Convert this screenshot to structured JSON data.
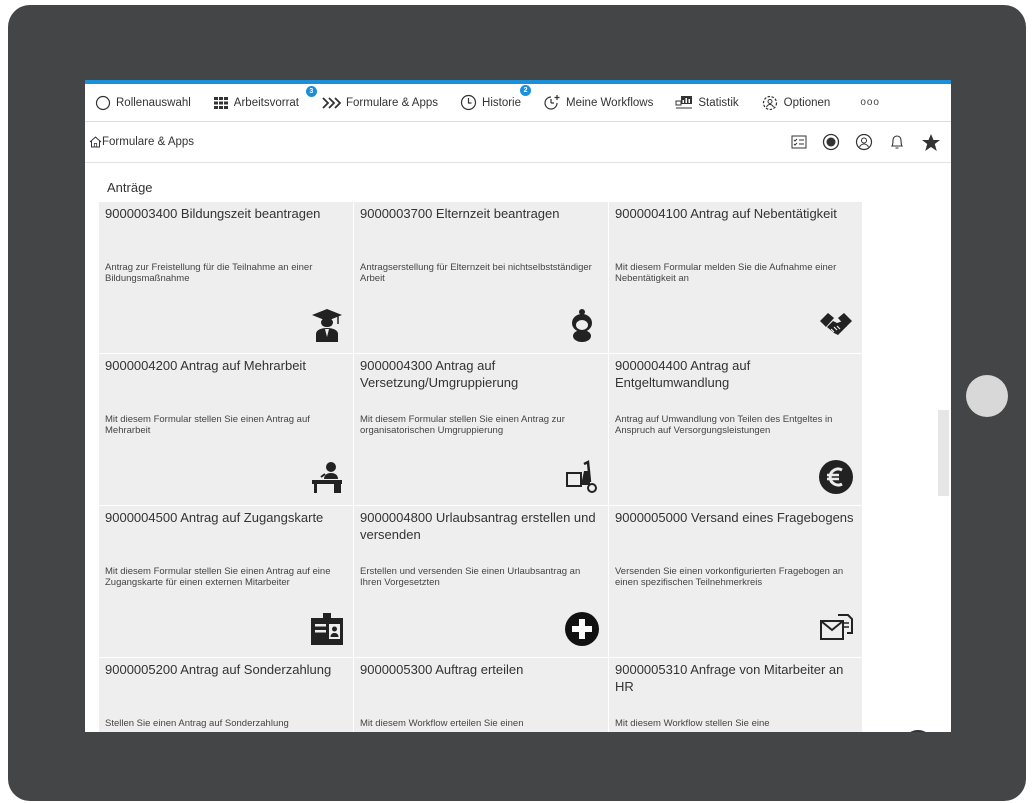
{
  "nav": {
    "items": [
      {
        "label": "Rollenauswahl",
        "icon": "circle-icon"
      },
      {
        "label": "Arbeitsvorrat",
        "icon": "grid-icon",
        "badge": "3"
      },
      {
        "label": "Formulare & Apps",
        "icon": "chevrons-right-icon"
      },
      {
        "label": "Historie",
        "icon": "clock-icon",
        "badge": "2"
      },
      {
        "label": "Meine Workflows",
        "icon": "workflow-icon"
      },
      {
        "label": "Statistik",
        "icon": "statistics-icon"
      },
      {
        "label": "Optionen",
        "icon": "settings-users-icon"
      }
    ],
    "more": "ooo"
  },
  "breadcrumb": {
    "label": "Formulare & Apps"
  },
  "section": {
    "title": "Anträge"
  },
  "tiles": [
    {
      "title": "9000003400 Bildungszeit beantragen",
      "desc": "Antrag zur Freistellung für die Teilnahme an einer Bildungsmaßnahme",
      "icon": "graduate-icon"
    },
    {
      "title": "9000003700 Elternzeit beantragen",
      "desc": "Antragserstellung für Elternzeit bei nichtselbstständiger Arbeit",
      "icon": "baby-icon"
    },
    {
      "title": "9000004100 Antrag auf Nebentätigkeit",
      "desc": "Mit diesem Formular melden Sie die Aufnahme einer Nebentätigkeit an",
      "icon": "handshake-icon"
    },
    {
      "title": "9000004200 Antrag auf Mehrarbeit",
      "desc": "Mit diesem Formular stellen Sie einen Antrag auf Mehrarbeit",
      "icon": "desk-worker-icon"
    },
    {
      "title": "9000004300 Antrag auf Versetzung/Umgruppierung",
      "desc": "Mit diesem Formular stellen Sie einen Antrag zur organisatorischen Umgruppierung",
      "icon": "moving-box-icon"
    },
    {
      "title": "9000004400 Antrag auf Entgeltumwandlung",
      "desc": "Antrag auf Umwandlung von Teilen des Entgeltes in Anspruch auf Versorgungsleistungen",
      "icon": "euro-icon"
    },
    {
      "title": "9000004500 Antrag auf Zugangskarte",
      "desc": "Mit diesem Formular stellen Sie einen Antrag auf eine Zugangskarte für einen externen Mitarbeiter",
      "icon": "id-card-icon"
    },
    {
      "title": "9000004800 Urlaubsantrag erstellen und versenden",
      "desc": "Erstellen und versenden Sie einen Urlaubsantrag an Ihren Vorgesetzten",
      "icon": "plus-circle-icon"
    },
    {
      "title": "9000005000 Versand eines Fragebogens",
      "desc": "Versenden Sie einen vorkonfigurierten Fragebogen an einen spezifischen Teilnehmerkreis",
      "icon": "envelope-icon"
    },
    {
      "title": "9000005200 Antrag auf Sonderzahlung",
      "desc": "Stellen Sie einen Antrag auf Sonderzahlung",
      "icon": ""
    },
    {
      "title": "9000005300 Auftrag erteilen",
      "desc": "Mit diesem Workflow erteilen Sie einen",
      "icon": ""
    },
    {
      "title": "9000005310 Anfrage von Mitarbeiter an HR",
      "desc": "Mit diesem Workflow stellen Sie eine",
      "icon": ""
    }
  ]
}
